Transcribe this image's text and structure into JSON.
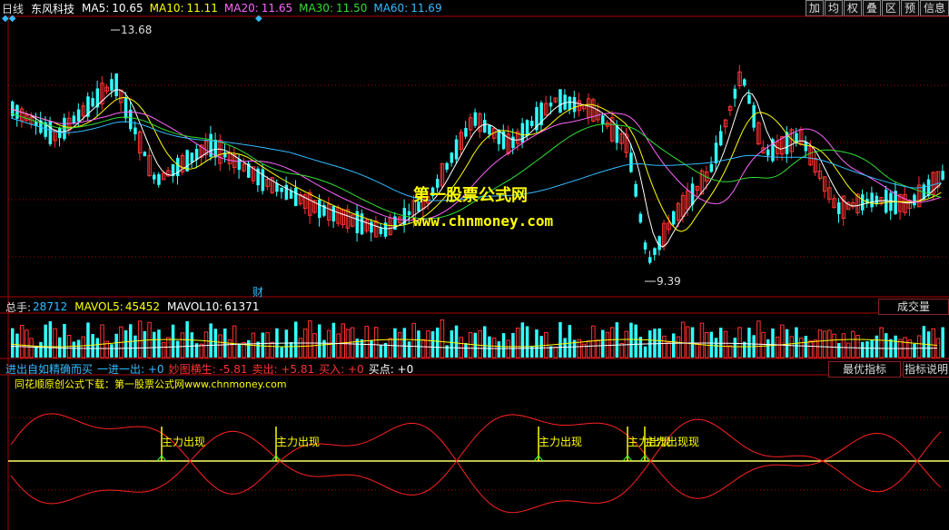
{
  "header": {
    "period": "日线",
    "stock_name": "东风科技",
    "ma": [
      {
        "label": "MA5:",
        "value": "10.65",
        "color": "#ffffff"
      },
      {
        "label": "MA10:",
        "value": "11.11",
        "color": "#ffff00"
      },
      {
        "label": "MA20:",
        "value": "11.65",
        "color": "#ff66ff"
      },
      {
        "label": "MA30:",
        "value": "11.50",
        "color": "#33dd33"
      },
      {
        "label": "MA60:",
        "value": "11.69",
        "color": "#33bbff"
      }
    ],
    "toolbar": [
      "加",
      "均",
      "权",
      "叠",
      "区",
      "预",
      "信息"
    ]
  },
  "price_chart": {
    "high_label": "13.68",
    "low_label": "9.39",
    "cai_label": "财",
    "watermark_cn": "第一股票公式网",
    "watermark_url": "www.chnmoney.com"
  },
  "volume_panel": {
    "label": "总手:",
    "value": "28712",
    "mavol5_label": "MAVOL5:",
    "mavol5": "45452",
    "mavol10_label": "MAVOL10:",
    "mavol10": "61371",
    "button": "成交量"
  },
  "indicator_panel": {
    "line1": [
      {
        "text": "进出自如精确而买",
        "color": "#33bbff"
      },
      {
        "text": "一进一出: +0",
        "color": "#33bbff"
      },
      {
        "text": "妙图横生: -5.81",
        "color": "#ff3333"
      },
      {
        "text": "卖出: +5.81",
        "color": "#ff3333"
      },
      {
        "text": "买入: +0",
        "color": "#ff3333"
      },
      {
        "text": "买点: +0",
        "color": "#ffffff"
      }
    ],
    "line2": "同花顺原创公式下载：第一股票公式网www.chnmoney.com",
    "buttons": [
      "最优指标",
      "指标说明"
    ],
    "signal_label": "主力出现",
    "overlap_label": "主力出现现"
  },
  "colors": {
    "up": "#ff3333",
    "down": "#33ffff",
    "grid": "#aa0000",
    "frame": "#aa0000"
  }
}
